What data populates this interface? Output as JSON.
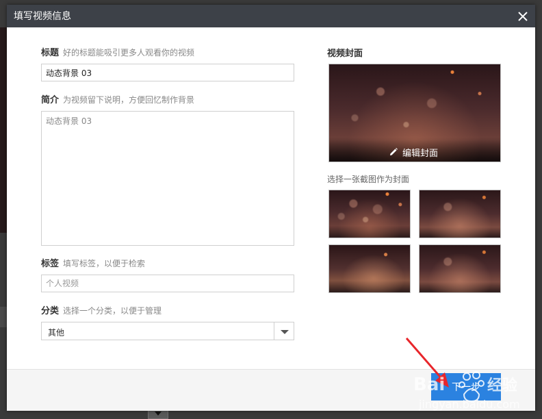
{
  "dialog": {
    "title": "填写视频信息",
    "close_icon": "close-icon"
  },
  "form": {
    "title": {
      "label": "标题",
      "hint": "好的标题能吸引更多人观看你的视频",
      "value": "动态背景 03"
    },
    "description": {
      "label": "简介",
      "hint": "为视频留下说明，方便回忆制作背景",
      "value": "动态背景 03"
    },
    "tags": {
      "label": "标签",
      "hint": "填写标签，以便于检索",
      "placeholder": "个人视频"
    },
    "category": {
      "label": "分类",
      "hint": "选择一个分类，以便于管理",
      "selected": "其他"
    }
  },
  "cover": {
    "title": "视频封面",
    "edit_label": "编辑封面",
    "edit_icon": "pencil-icon",
    "pick_hint": "选择一张截图作为封面",
    "thumbnail_count": 4
  },
  "footer": {
    "next_label": "下一步"
  },
  "colors": {
    "header_bg": "#3d4148",
    "primary_button": "#2b82e0",
    "annotation_arrow": "#e8262b"
  }
}
